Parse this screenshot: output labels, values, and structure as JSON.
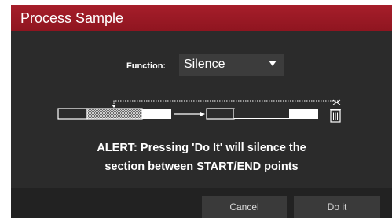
{
  "dialog": {
    "title": "Process Sample",
    "function_label": "Function:",
    "function_value": "Silence",
    "alert_line1": "ALERT: Pressing 'Do It' will silence the",
    "alert_line2": "section between START/END points",
    "cancel_label": "Cancel",
    "doit_label": "Do it"
  },
  "icons": {
    "dropdown": "caret-down-icon",
    "trash": "trash-icon",
    "arrow": "arrow-right-icon",
    "scissors": "scissors-icon"
  },
  "colors": {
    "title_bar": "#9b1a25",
    "dialog_bg": "#2b2b2b",
    "footer_bg": "#222222",
    "button_bg": "#3a3a3a"
  }
}
